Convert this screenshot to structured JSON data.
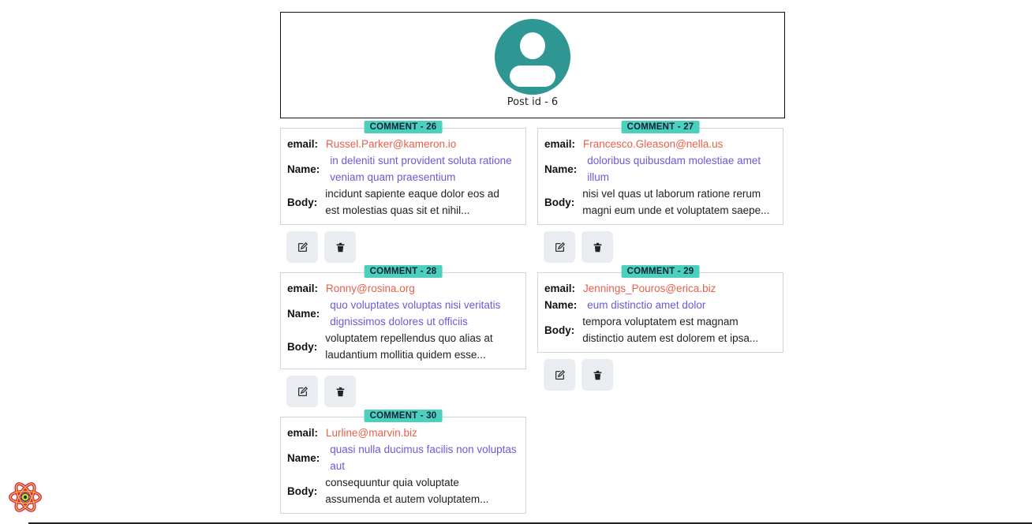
{
  "post": {
    "label": "Post id - 6"
  },
  "comments": [
    {
      "badge": "COMMENT - 26",
      "email_label": "email:",
      "email": "Russel.Parker@kameron.io",
      "name_label": "Name:",
      "name": "in deleniti sunt provident soluta ratione veniam quam praesentium",
      "body_label": "Body:",
      "body": "incidunt sapiente eaque dolor eos ad est molestias quas sit et nihil..."
    },
    {
      "badge": "COMMENT - 27",
      "email_label": "email:",
      "email": "Francesco.Gleason@nella.us",
      "name_label": "Name:",
      "name": "doloribus quibusdam molestiae amet illum",
      "body_label": "Body:",
      "body": "nisi vel quas ut laborum ratione rerum magni eum unde et voluptatem saepe..."
    },
    {
      "badge": "COMMENT - 28",
      "email_label": "email:",
      "email": "Ronny@rosina.org",
      "name_label": "Name:",
      "name": "quo voluptates voluptas nisi veritatis dignissimos dolores ut officiis",
      "body_label": "Body:",
      "body": "voluptatem repellendus quo alias at laudantium mollitia quidem esse..."
    },
    {
      "badge": "COMMENT - 29",
      "email_label": "email:",
      "email": "Jennings_Pouros@erica.biz",
      "name_label": "Name:",
      "name": "eum distinctio amet dolor",
      "body_label": "Body:",
      "body": "tempora voluptatem est magnam distinctio autem est dolorem et ipsa..."
    },
    {
      "badge": "COMMENT - 30",
      "email_label": "email:",
      "email": "Lurline@marvin.biz",
      "name_label": "Name:",
      "name": "quasi nulla ducimus facilis non voluptas aut",
      "body_label": "Body:",
      "body": "consequuntur quia voluptate assumenda et autem voluptatem..."
    }
  ],
  "icons": {
    "edit": "edit-icon",
    "delete": "trash-icon",
    "avatar": "user-avatar-icon",
    "devtools": "react-logo-icon"
  },
  "colors": {
    "badge": "#4ad0bd",
    "email": "#e8604a",
    "name": "#6a5bd6",
    "avatar": "#2e9693",
    "button": "#e9edf1"
  }
}
